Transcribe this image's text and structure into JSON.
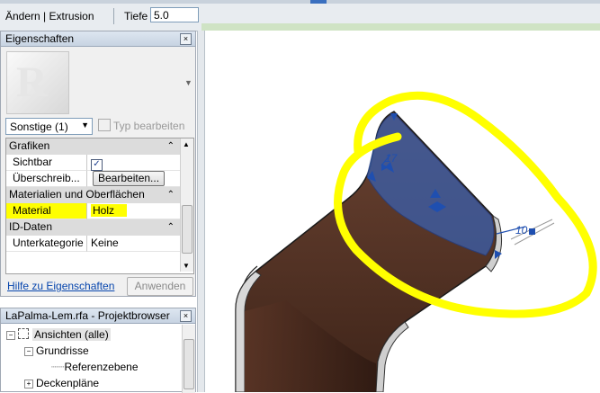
{
  "ribbon": {
    "context_label": "Ändern | Extrusion",
    "depth_label": "Tiefe",
    "depth_value": "5.0"
  },
  "properties": {
    "title": "Eigenschaften",
    "type_selector": "Sonstige (1)",
    "edit_type_label": "Typ bearbeiten",
    "groups": {
      "graphics": "Grafiken",
      "materials": "Materialien und Oberflächen",
      "id_data": "ID-Daten"
    },
    "rows": {
      "visible_label": "Sichtbar",
      "override_label": "Überschreib...",
      "override_button": "Bearbeiten...",
      "material_label": "Material",
      "material_value": "Holz",
      "subcategory_label": "Unterkategorie",
      "subcategory_value": "Keine"
    },
    "help_link": "Hilfe zu Eigenschaften",
    "apply_button": "Anwenden"
  },
  "project_browser": {
    "title": "LaPalma-Lem.rfa - Projektbrowser",
    "nodes": {
      "views": "Ansichten (alle)",
      "floor_plans": "Grundrisse",
      "ref_level": "Referenzebene",
      "ceiling_plans": "Deckenpläne"
    }
  },
  "canvas": {
    "dim_left": "17",
    "dim_right": "10"
  },
  "colors": {
    "highlight": "#ffff00",
    "selection_blue": "#1f4fb0",
    "wood": "#4a2a1e"
  }
}
